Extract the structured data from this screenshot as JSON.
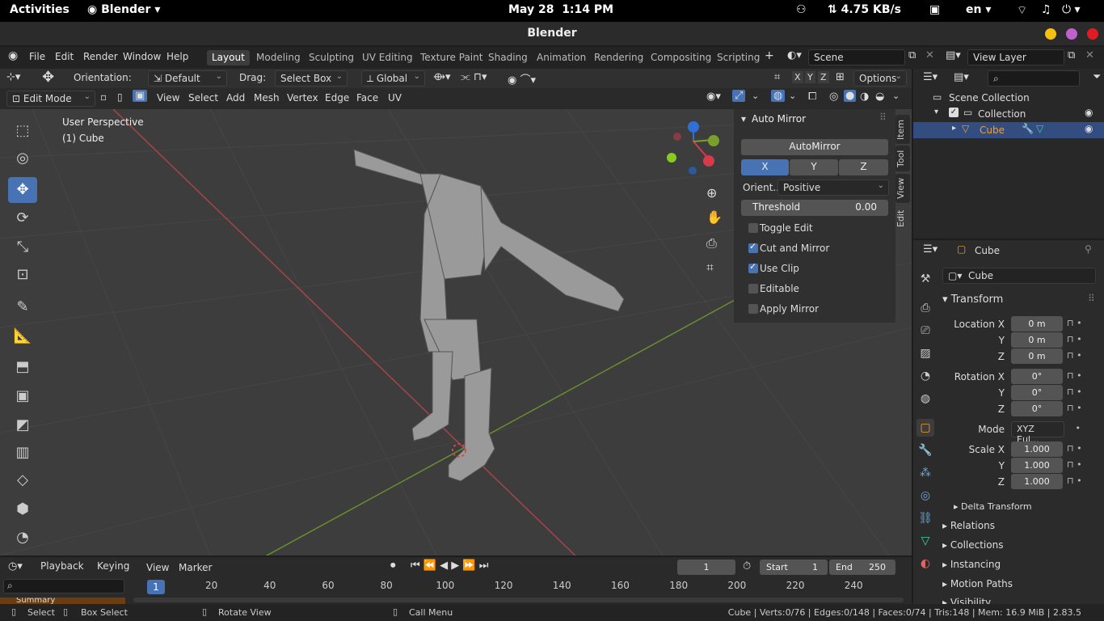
{
  "gnome": {
    "activities": "Activities",
    "app": "Blender",
    "date": "May 28",
    "time": "1:14 PM",
    "net": "⇅ 4.75 KB/s",
    "lang": "en"
  },
  "window": {
    "title": "Blender"
  },
  "menu": {
    "items": [
      "File",
      "Edit",
      "Render",
      "Window",
      "Help"
    ]
  },
  "workspaces": [
    "Layout",
    "Modeling",
    "Sculpting",
    "UV Editing",
    "Texture Paint",
    "Shading",
    "Animation",
    "Rendering",
    "Compositing",
    "Scripting"
  ],
  "scene": {
    "label": "Scene",
    "view_layer": "View Layer"
  },
  "tool_settings": {
    "orientation_label": "Orientation:",
    "orientation": "Default",
    "drag_label": "Drag:",
    "drag": "Select Box",
    "transform": "Global",
    "options": "Options"
  },
  "viewport_header": {
    "mode": "Edit Mode",
    "items": [
      "View",
      "Select",
      "Add",
      "Mesh",
      "Vertex",
      "Edge",
      "Face",
      "UV"
    ]
  },
  "viewport": {
    "perspective": "User Perspective",
    "object": "(1) Cube"
  },
  "npanel": {
    "title": "Auto Mirror",
    "automirror_btn": "AutoMirror",
    "axes": [
      "X",
      "Y",
      "Z"
    ],
    "orient_label": "Orient...",
    "orient_value": "Positive",
    "threshold_label": "Threshold",
    "threshold_value": "0.00",
    "checks": [
      {
        "label": "Toggle Edit",
        "checked": false
      },
      {
        "label": "Cut and Mirror",
        "checked": true
      },
      {
        "label": "Use Clip",
        "checked": true
      },
      {
        "label": "Editable",
        "checked": false
      },
      {
        "label": "Apply Mirror",
        "checked": false
      }
    ],
    "tabs": [
      "Item",
      "Tool",
      "View",
      "Edit"
    ]
  },
  "outliner": {
    "scene_collection": "Scene Collection",
    "collection": "Collection",
    "object": "Cube"
  },
  "properties": {
    "object_name": "Cube",
    "data_name": "Cube",
    "transform_label": "Transform",
    "location": {
      "label": "Location X",
      "x": "0 m",
      "y": "0 m",
      "z": "0 m"
    },
    "rotation": {
      "label": "Rotation X",
      "x": "0°",
      "y": "0°",
      "z": "0°"
    },
    "mode_label": "Mode",
    "mode_value": "XYZ Eul...",
    "scale": {
      "label": "Scale X",
      "x": "1.000",
      "y": "1.000",
      "z": "1.000"
    },
    "axis_y": "Y",
    "axis_z": "Z",
    "delta": "Delta Transform",
    "sections": [
      "Relations",
      "Collections",
      "Instancing",
      "Motion Paths",
      "Visibility"
    ]
  },
  "timeline": {
    "playback": "Playback",
    "keying": "Keying",
    "view": "View",
    "marker": "Marker",
    "current_frame": "1",
    "start_label": "Start",
    "start": "1",
    "end_label": "End",
    "end": "250",
    "ticks": [
      "1",
      "20",
      "40",
      "60",
      "80",
      "100",
      "120",
      "140",
      "160",
      "180",
      "200",
      "220",
      "240"
    ],
    "summary": "Summary"
  },
  "status": {
    "select": "Select",
    "box_select": "Box Select",
    "rotate": "Rotate View",
    "call_menu": "Call Menu",
    "stats": "Cube | Verts:0/76 | Edges:0/148 | Faces:0/74 | Tris:148 | Mem: 16.9 MiB | 2.83.5"
  }
}
